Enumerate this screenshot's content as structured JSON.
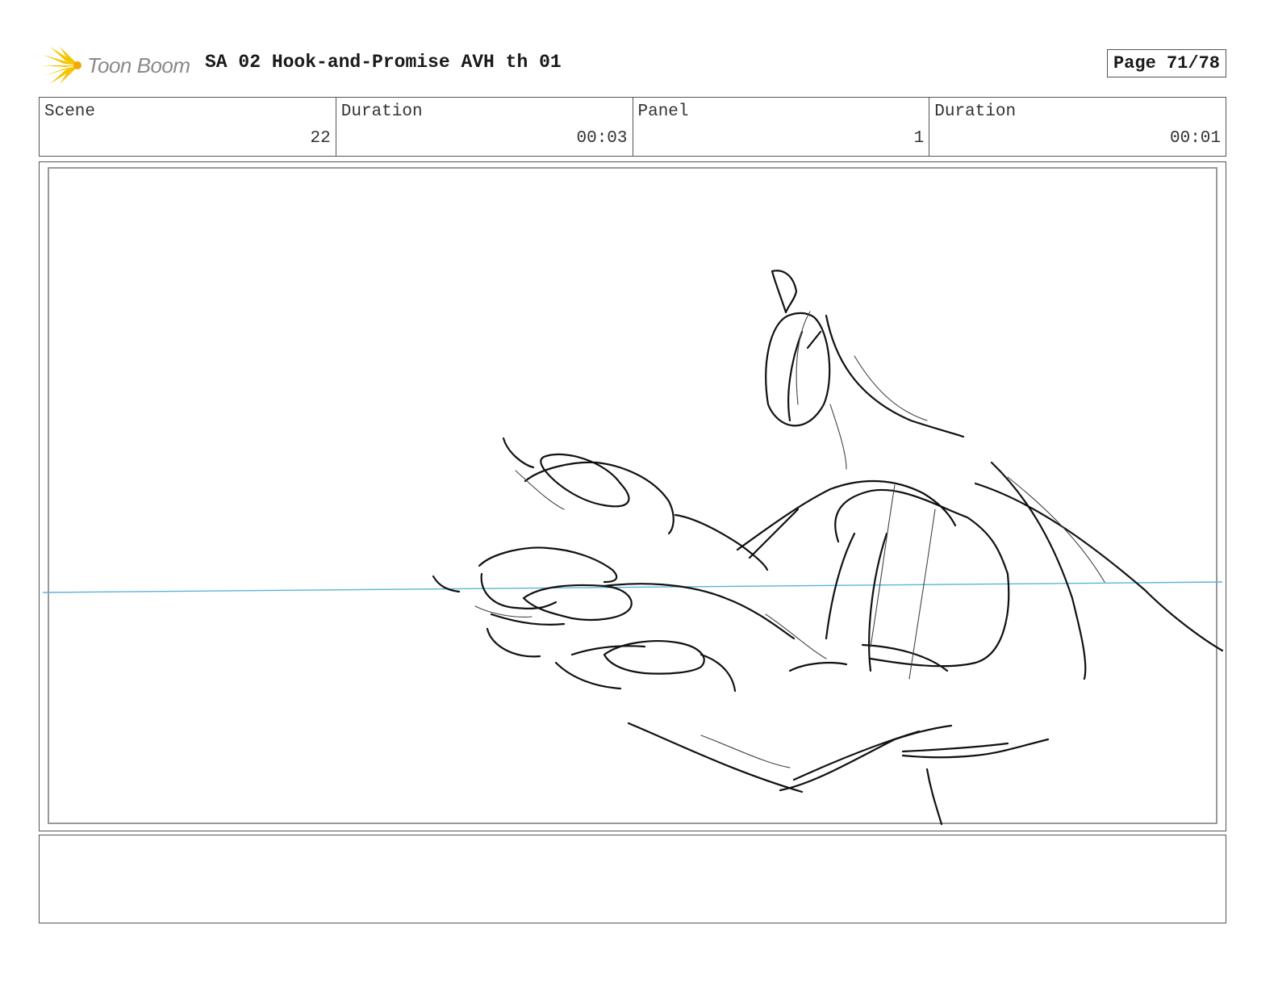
{
  "header": {
    "brand": "Toon Boom",
    "logo_icon": "toon-boom-burst-icon",
    "title": "SA 02 Hook-and-Promise AVH th 01",
    "page": "Page 71/78"
  },
  "info": {
    "scene_label": "Scene",
    "scene_value": "22",
    "scene_duration_label": "Duration",
    "scene_duration_value": "00:03",
    "panel_label": "Panel",
    "panel_value": "1",
    "panel_duration_label": "Duration",
    "panel_duration_value": "00:01"
  },
  "panel": {
    "image": "hand-sketch-drawing",
    "horizon_color": "#5bb4d8"
  },
  "notes": {
    "text": ""
  }
}
